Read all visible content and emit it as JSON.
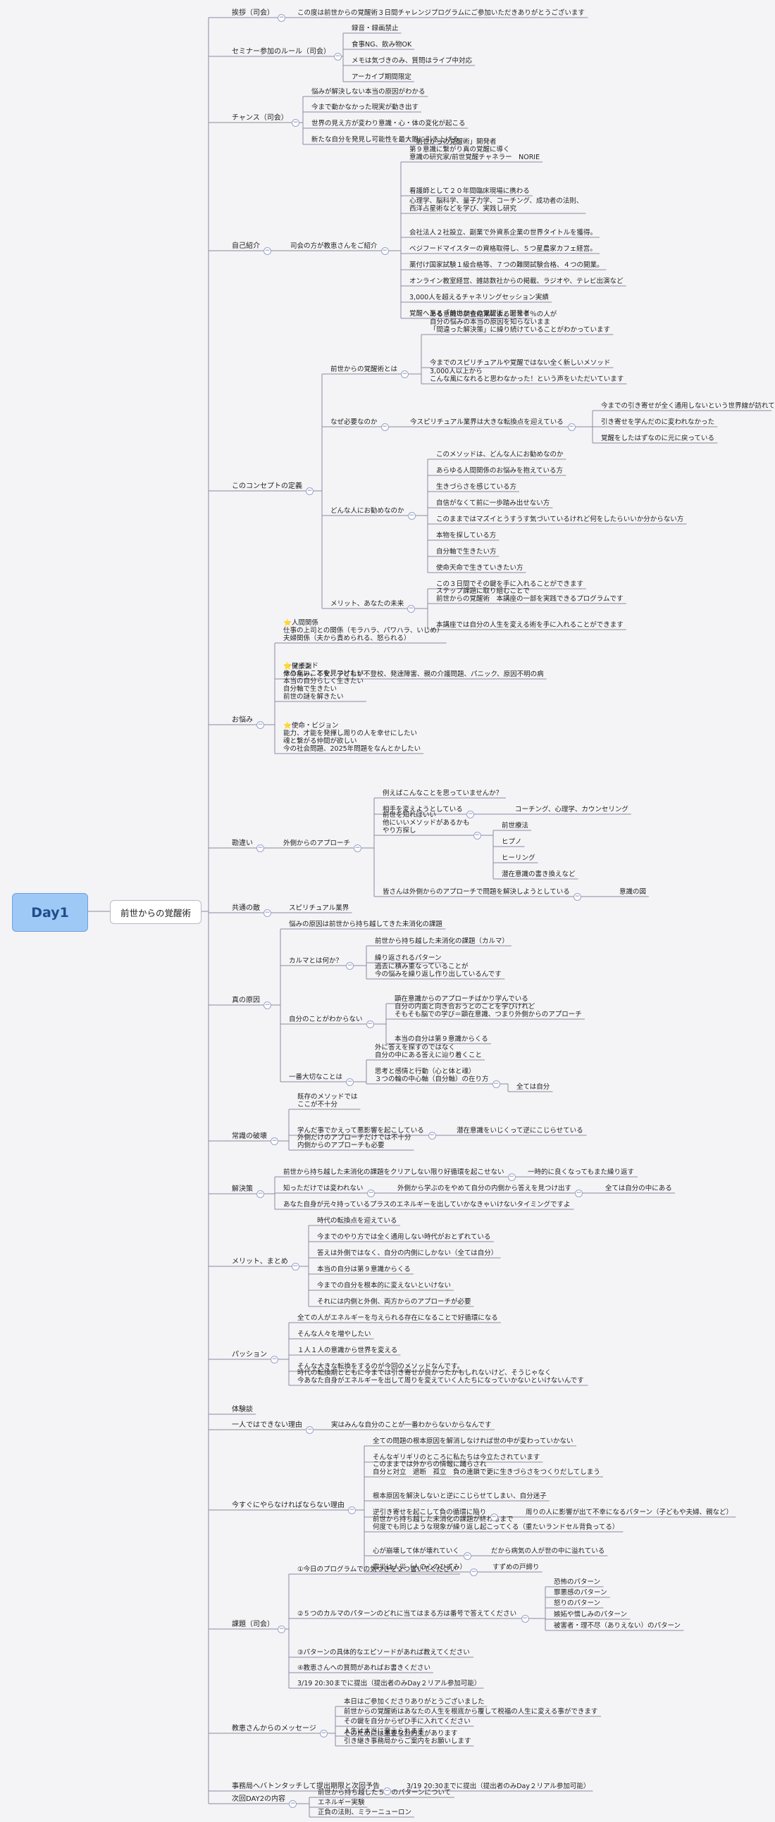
{
  "root": {
    "label": "Day1"
  },
  "main": {
    "label": "前世からの覚醒術"
  },
  "nodes": [
    {
      "id": "a1",
      "label": "挨拶（司会）"
    },
    {
      "id": "a2",
      "label": "この度は前世からの覚醒術３日間チャレンジプログラムにご参加いただきありがとうございます"
    },
    {
      "id": "b1",
      "label": "セミナー参加のルール（司会）"
    },
    {
      "id": "b2",
      "label": "録音・録画禁止"
    },
    {
      "id": "b3",
      "label": "食事NG、飲み物OK"
    },
    {
      "id": "b4",
      "label": "メモは気づきのみ、質問はライブ中対応"
    },
    {
      "id": "b5",
      "label": "アーカイブ期間限定"
    },
    {
      "id": "c1",
      "label": "チャンス（司会）"
    },
    {
      "id": "c2",
      "label": "悩みが解決しない本当の原因がわかる"
    },
    {
      "id": "c3",
      "label": "今まで動かなかった現実が動き出す"
    },
    {
      "id": "c4",
      "label": "世界の見え方が変わり意識・心・体の変化が起こる"
    },
    {
      "id": "c5",
      "label": "新たな自分を発見し可能性を最大限に引き上げる"
    },
    {
      "id": "d1",
      "label": "自己紹介"
    },
    {
      "id": "d2",
      "label": "司会の方が教恵さんをご紹介"
    },
    {
      "id": "d3",
      "label": "「前世からの覚醒術」開発者\n第９意識に繋がり真の覚醒に導く\n意識の研究家/前世覚醒チャネラー　NORIE"
    },
    {
      "id": "d4",
      "label": "看護師として２０年間臨床現場に携わる"
    },
    {
      "id": "d5",
      "label": "心理学、脳科学、量子力学、コーチング、成功者の法則、\n西洋占星術などを学び、実践し研究"
    },
    {
      "id": "d6",
      "label": "会社法人２社設立、副業で外資系企業の世界タイトルを獲得。"
    },
    {
      "id": "d7",
      "label": "ベジフードマイスターの資格取得し、５つ星農家カフェ経営。"
    },
    {
      "id": "d8",
      "label": "薬付け国家試験１級合格等、７つの難関試験合格、４つの開業。"
    },
    {
      "id": "d9",
      "label": "オンライン教室経営、雑誌数社からの掲載、ラジオや、テレビ出演など"
    },
    {
      "id": "d10",
      "label": "3,000人を超えるチャネリングセッション実績"
    },
    {
      "id": "d11",
      "label": "覚醒へ至る「前世からの覚醒術」開発者"
    },
    {
      "id": "e1",
      "label": "このコンセプトの定義"
    },
    {
      "id": "e2",
      "label": "前世からの覚醒術とは"
    },
    {
      "id": "e3",
      "label": "ある意識の調査結果によると８７％の人が\n自分の悩みの本当の原因を知らないまま\n「間違った解決策」に繰り続けていることがわかっています"
    },
    {
      "id": "e4",
      "label": "今までのスピリチュアルや覚醒ではない全く新しいメソッド"
    },
    {
      "id": "e5",
      "label": "3,000人以上から\nこんな風になれると思わなかった！という声をいただいています"
    },
    {
      "id": "e6",
      "label": "なぜ必要なのか"
    },
    {
      "id": "e7",
      "label": "今スピリチュアル業界は大きな転換点を迎えている"
    },
    {
      "id": "e8",
      "label": "今までの引き寄せが全く通用しないという世界線が訪れている"
    },
    {
      "id": "e9",
      "label": "引き寄せを学んだのに変われなかった"
    },
    {
      "id": "e10",
      "label": "覚醒をしたはずなのに元に戻っている"
    },
    {
      "id": "e11",
      "label": "どんな人にお勧めなのか"
    },
    {
      "id": "e12",
      "label": "このメソッドは、どんな人にお勧めなのか"
    },
    {
      "id": "e13",
      "label": "あらゆる人間関係のお悩みを抱えている方"
    },
    {
      "id": "e14",
      "label": "生きづらさを感じている方"
    },
    {
      "id": "e15",
      "label": "自信がなくて前に一歩踏み出せない方"
    },
    {
      "id": "e16",
      "label": "このままではマズイとうすうす気づいているけれど何をしたらいいか分からない方"
    },
    {
      "id": "e17",
      "label": "本物を探している方"
    },
    {
      "id": "e18",
      "label": "自分軸で生きたい方"
    },
    {
      "id": "e19",
      "label": "使命天命で生きていきたい方"
    },
    {
      "id": "e20",
      "label": "メリット、あなたの未来"
    },
    {
      "id": "e21",
      "label": "この３日間でその鍵を手に入れることができます"
    },
    {
      "id": "e22",
      "label": "ステップ課題に取り組むことで\n前世からの覚醒術　本講座の一部を実践できるプログラムです"
    },
    {
      "id": "e23",
      "label": "本講座では自分の人生を変える術を手に入れることができます"
    },
    {
      "id": "f1",
      "label": "お悩み"
    },
    {
      "id": "f2",
      "label": "⭐人間関係\n仕事の上司との関係（モラハラ、パワハラ、いじめ）\n夫婦関係（夫から責められる、怒られる）"
    },
    {
      "id": "f3",
      "label": "⭐健康面\n体の痛み、不安、子どもが不登校、発達障害、親の介護問題、パニック、原因不明の病"
    },
    {
      "id": "f4",
      "label": "⭐マインド\nやりたいことを見つけたい\n本当の自分らしく生きたい\n自分軸で生きたい\n前世の謎を解きたい"
    },
    {
      "id": "f5",
      "label": "⭐使命・ビジョン\n能力、才能を発揮し周りの人を幸せにしたい\n魂と繋がる仲間が欲しい\n今の社会問題、2025年問題をなんとかしたい"
    },
    {
      "id": "g1",
      "label": "勘違い"
    },
    {
      "id": "g2",
      "label": "外側からのアプローチ"
    },
    {
      "id": "g3",
      "label": "例えばこんなことを思っていませんか？"
    },
    {
      "id": "g4",
      "label": "相手を変えようとしている"
    },
    {
      "id": "g5",
      "label": "コーチング、心理学、カウンセリング"
    },
    {
      "id": "g6",
      "label": "前世を知ればいい\n他にいいメソッドがあるかも\nやり方探し"
    },
    {
      "id": "g7",
      "label": "前世療法"
    },
    {
      "id": "g8",
      "label": "ヒプノ"
    },
    {
      "id": "g9",
      "label": "ヒーリング"
    },
    {
      "id": "g10",
      "label": "潜在意識の書き換えなど"
    },
    {
      "id": "g11",
      "label": "皆さんは外側からのアプローチで問題を解決しようとしている"
    },
    {
      "id": "g12",
      "label": "意識の図"
    },
    {
      "id": "h1",
      "label": "共通の敵"
    },
    {
      "id": "h2",
      "label": "スピリチュアル業界"
    },
    {
      "id": "i1",
      "label": "真の原因"
    },
    {
      "id": "i2",
      "label": "悩みの原因は前世から持ち越してきた未消化の課題"
    },
    {
      "id": "i3",
      "label": "カルマとは何か？"
    },
    {
      "id": "i4",
      "label": "前世から持ち越した未消化の課題（カルマ）"
    },
    {
      "id": "i5",
      "label": "繰り返されるパターン"
    },
    {
      "id": "i6",
      "label": "過去に積み重なっていることが\n今の悩みを繰り返し作り出しているんです"
    },
    {
      "id": "i7",
      "label": "自分のことがわからない"
    },
    {
      "id": "i8",
      "label": "顕在意識からのアプローチばかり学んでいる"
    },
    {
      "id": "i9",
      "label": "自分の内面と向き合おうとのことを学びけれど\nそもそも脳での学び＝顕在意識、つまり外側からのアプローチ"
    },
    {
      "id": "i10",
      "label": "本当の自分は第９意識からくる"
    },
    {
      "id": "i11",
      "label": "一番大切なことは"
    },
    {
      "id": "i12",
      "label": "外に答えを探すのではなく\n自分の中にある答えに辿り着くこと"
    },
    {
      "id": "i13",
      "label": "思考と感情と行動（心と体と魂）\n３つの輪の中心軸（自分軸）の在り方"
    },
    {
      "id": "i14",
      "label": "全ては自分"
    },
    {
      "id": "j1",
      "label": "常識の破壊"
    },
    {
      "id": "j2",
      "label": "既存のメソッドでは\nここが不十分"
    },
    {
      "id": "j3",
      "label": "学んだ事でかえって悪影響を起こしている"
    },
    {
      "id": "j4",
      "label": "潜在意識をいじくって逆にこじらせている"
    },
    {
      "id": "j5",
      "label": "外側だけのアプローチだけでは不十分\n内側からのアプローチも必要"
    },
    {
      "id": "k1",
      "label": "解決策"
    },
    {
      "id": "k2",
      "label": "前世から持ち越した未消化の課題をクリアしない限り好循環を起こせない"
    },
    {
      "id": "k3",
      "label": "一時的に良くなってもまた繰り返す"
    },
    {
      "id": "k4",
      "label": "知っただけでは変われない"
    },
    {
      "id": "k5",
      "label": "外側から学ぶのをやめて自分の内側から答えを見つけ出す"
    },
    {
      "id": "k6",
      "label": "全ては自分の中にある"
    },
    {
      "id": "k7",
      "label": "あなた自身が元々持っているプラスのエネルギーを出していかなきゃいけないタイミングですよ"
    },
    {
      "id": "l1",
      "label": "メリット、まとめ"
    },
    {
      "id": "l2",
      "label": "時代の転換点を迎えている"
    },
    {
      "id": "l3",
      "label": "今までのやり方では全く通用しない時代がおとずれている"
    },
    {
      "id": "l4",
      "label": "答えは外側ではなく、自分の内側にしかない（全ては自分）"
    },
    {
      "id": "l5",
      "label": "本当の自分は第９意識からくる"
    },
    {
      "id": "l6",
      "label": "今までの自分を根本的に変えないといけない"
    },
    {
      "id": "l7",
      "label": "それには内側と外側、両方からのアプローチが必要"
    },
    {
      "id": "m1",
      "label": "パッション"
    },
    {
      "id": "m2",
      "label": "全ての人がエネルギーを与えられる存在になることで好循環になる"
    },
    {
      "id": "m3",
      "label": "そんな人々を増やしたい"
    },
    {
      "id": "m4",
      "label": "１人１人の意識から世界を変える"
    },
    {
      "id": "m5",
      "label": "そんな大きな転換をするのが今回のメソッドなんです。"
    },
    {
      "id": "m6",
      "label": "時代の転換期とともに今までは引き寄せが良かったかもしれないけど、そうじゃなく\n今あなた自身がエネルギーを出して周りを変えていく人たちになっていかないといけないんです"
    },
    {
      "id": "n1",
      "label": "体験談"
    },
    {
      "id": "o1",
      "label": "一人ではできない理由"
    },
    {
      "id": "o2",
      "label": "実はみんな自分のことが一番わからないからなんです"
    },
    {
      "id": "p1",
      "label": "今すぐにやらなければならない理由"
    },
    {
      "id": "p2",
      "label": "全ての問題の根本原因を解消しなければ世の中が変わっていかない"
    },
    {
      "id": "p3",
      "label": "そんなギリギリのところに私たちは今立たされています"
    },
    {
      "id": "p4",
      "label": "このままでは外からの情報に踊らされ\n自分と対立　遮断　孤立　負の連鎖で更に生きづらさをつくりだしてしまう"
    },
    {
      "id": "p5",
      "label": "根本原因を解決しないと逆にこじらせてしまい、自分迷子"
    },
    {
      "id": "p6",
      "label": "逆引き寄せを起こして負の循環に陥り"
    },
    {
      "id": "p7",
      "label": "周りの人に影響が出て不幸になるパターン（子どもや夫婦、親など）"
    },
    {
      "id": "p8",
      "label": "前世から持ち越した未消化の課題が終わるまで\n何度でも同じような現象が繰り返し起こってくる（重たいランドセル背負ってる）"
    },
    {
      "id": "p9",
      "label": "心が崩壊して体が壊れていく"
    },
    {
      "id": "p10",
      "label": "だから病気の人が世の中に溢れている"
    },
    {
      "id": "p11",
      "label": "震災は人災（人の心のひずみ）"
    },
    {
      "id": "p12",
      "label": "すずめの戸締り"
    },
    {
      "id": "q1",
      "label": "課題（司会）"
    },
    {
      "id": "q2",
      "label": "①今日のプログラムでの気づきを２つ書いてください"
    },
    {
      "id": "q3",
      "label": "②５つのカルマのパターンのどれに当てはまる方は番号で答えてください"
    },
    {
      "id": "q4",
      "label": "恐怖のパターン"
    },
    {
      "id": "q5",
      "label": "罪悪感のパターン"
    },
    {
      "id": "q6",
      "label": "怒りのパターン"
    },
    {
      "id": "q7",
      "label": "嫉妬や憎しみのパターン"
    },
    {
      "id": "q8",
      "label": "被害者・理不尽（ありえない）のパターン"
    },
    {
      "id": "q9",
      "label": "③パターンの具体的なエピソードがあれば教えてください"
    },
    {
      "id": "q10",
      "label": "④教恵さんへの質問があればお書きください"
    },
    {
      "id": "q11",
      "label": "3/19 20:30までに提出（提出者のみDay２リアル参加可能）"
    },
    {
      "id": "r1",
      "label": "教恵さんからのメッセージ"
    },
    {
      "id": "r2",
      "label": "本日はご参加くださりありがとうございました"
    },
    {
      "id": "r3",
      "label": "前世からの覚醒術はあなたの人生を根底から覆して税福の人生に変える事ができます"
    },
    {
      "id": "r4",
      "label": "その鍵を自分からぜひ手に入れてください"
    },
    {
      "id": "r5",
      "label": "人生は本当に変えられます"
    },
    {
      "id": "r6",
      "label": "そのためには重要なお約束があります\n引き継き事務局からご案内をお願いします"
    },
    {
      "id": "s1",
      "label": "事務局へバトンタッチして提出期限と次回予告"
    },
    {
      "id": "s2",
      "label": "3/19 20:30までに提出（提出者のみDay２リアル参加可能）"
    },
    {
      "id": "t1",
      "label": "次回DAY2の内容"
    },
    {
      "id": "t2",
      "label": "前世から持ち越した５つのパターンについて"
    },
    {
      "id": "t3",
      "label": "エネルギー実験"
    },
    {
      "id": "t4",
      "label": "正負の法則、ミラーニューロン"
    }
  ]
}
